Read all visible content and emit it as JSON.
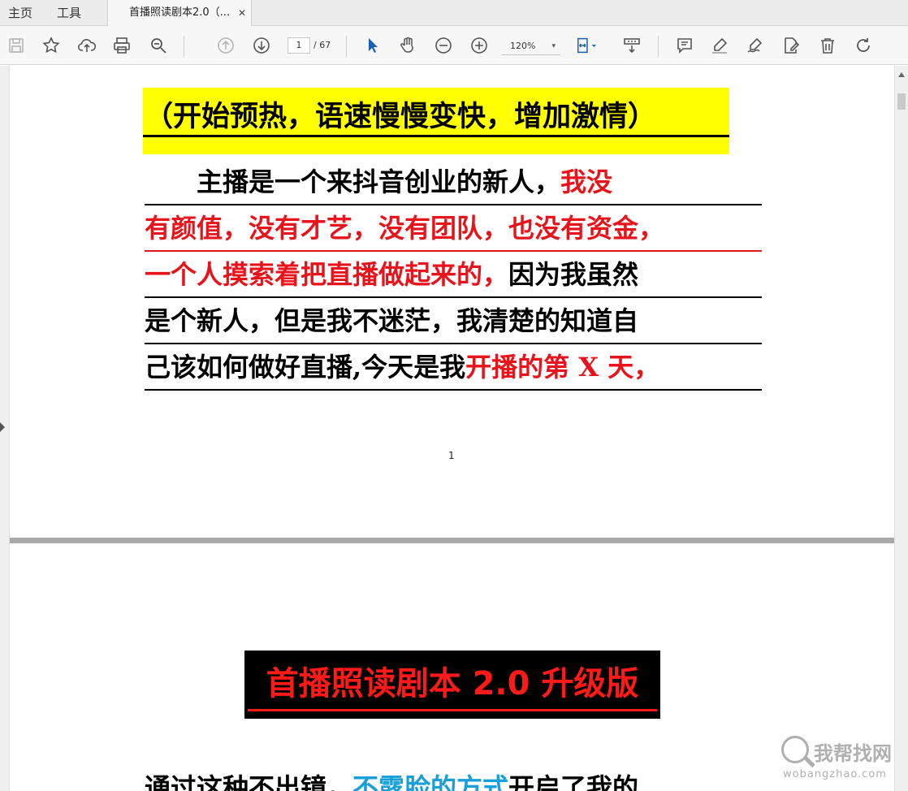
{
  "nav": {
    "home": "主页",
    "tools": "工具"
  },
  "tab": {
    "title": "首播照读剧本2.0（...",
    "close": "✕"
  },
  "toolbar": {
    "page_current": "1",
    "page_total": "/ 67",
    "zoom": "120%",
    "zoom_caret": "▾"
  },
  "page1": {
    "heading": "（开始预热，语速慢慢变快，增加激情）",
    "lines": [
      {
        "black1": "　　主播是一个来抖音创业的新人，",
        "red1": "我没"
      },
      {
        "red1": "有颜值，没有才艺，没有团队，也没有资金，"
      },
      {
        "red1": "一个人摸索着把直播做起来的，",
        "black1": "因为我虽然"
      },
      {
        "black1": "是个新人，但是我不迷茫，我清楚的知道自"
      },
      {
        "black1": "己该如何做好直播,今天是我",
        "red1": "开播的第 X 天，"
      }
    ],
    "page_number": "1"
  },
  "page2": {
    "heading": "首播照读剧本 2.0 升级版",
    "para_black1": "通过这种不出镜，",
    "para_blue": "不露脸的方式",
    "para_black2": "开启了我的"
  },
  "watermark": {
    "cn": "我帮找网",
    "en": "wobangzhao.com"
  },
  "colors": {
    "red": "#e8141c",
    "yellow": "#ffff00",
    "blue": "#1aa0d8",
    "accent": "#1a5fb4"
  }
}
